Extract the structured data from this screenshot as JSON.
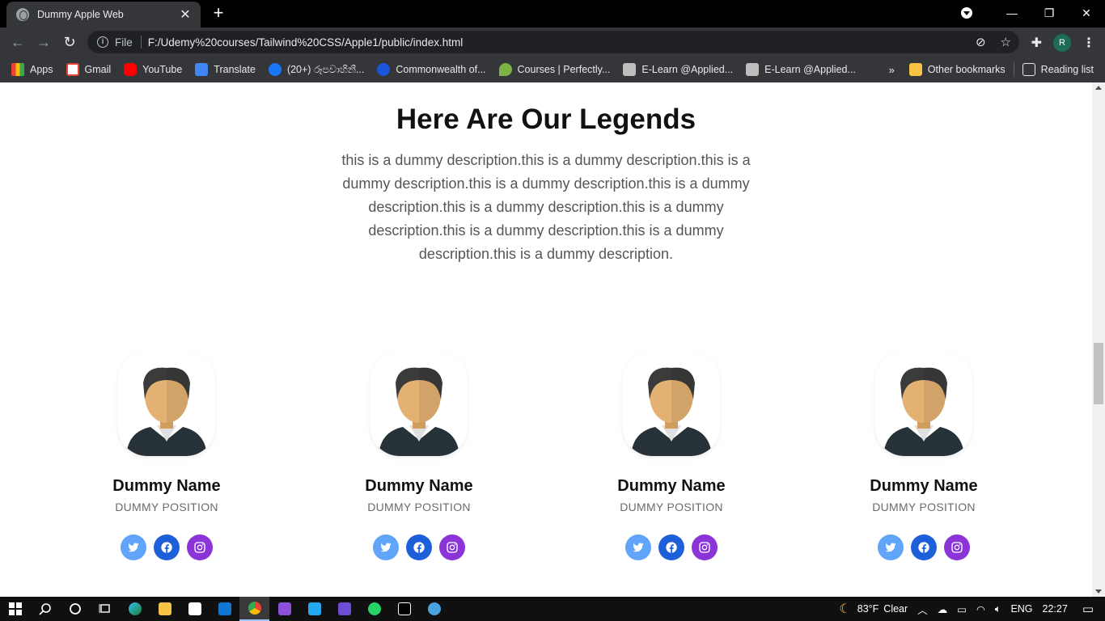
{
  "browser": {
    "tab_title": "Dummy Apple Web",
    "omnibox_file_label": "File",
    "url": "F:/Udemy%20courses/Tailwind%20CSS/Apple1/public/index.html",
    "avatar_letter": "R",
    "bookmarks": [
      {
        "label": "Apps",
        "color": "#e8453c"
      },
      {
        "label": "Gmail",
        "color": "#ea4335"
      },
      {
        "label": "YouTube",
        "color": "#ff0000"
      },
      {
        "label": "Translate",
        "color": "#4285f4"
      },
      {
        "label": "(20+) රූපවාහිනී...",
        "color": "#1877f2"
      },
      {
        "label": "Commonwealth of...",
        "color": "#1a56db"
      },
      {
        "label": "Courses | Perfectly...",
        "color": "#7cb342"
      },
      {
        "label": "E-Learn @Applied...",
        "color": "#9e9e9e"
      },
      {
        "label": "E-Learn @Applied...",
        "color": "#9e9e9e"
      }
    ],
    "other_bookmarks": "Other bookmarks",
    "reading_list": "Reading list"
  },
  "section": {
    "title": "Here Are Our Legends",
    "description": "this is a dummy description.this is a dummy description.this is a dummy description.this is a dummy description.this is a dummy description.this is a dummy description.this is a dummy description.this is a dummy description.this is a dummy description.this is a dummy description."
  },
  "team": [
    {
      "name": "Dummy Name",
      "position": "Dummy Position"
    },
    {
      "name": "Dummy Name",
      "position": "Dummy Position"
    },
    {
      "name": "Dummy Name",
      "position": "Dummy Position"
    },
    {
      "name": "Dummy Name",
      "position": "Dummy Position"
    }
  ],
  "social_colors": {
    "twitter": "#60a5fa",
    "facebook": "#1d5fd8",
    "instagram": "#8b35d9"
  },
  "taskbar": {
    "weather_temp": "83°F",
    "weather_text": "Clear",
    "language": "ENG",
    "time": "22:27"
  }
}
